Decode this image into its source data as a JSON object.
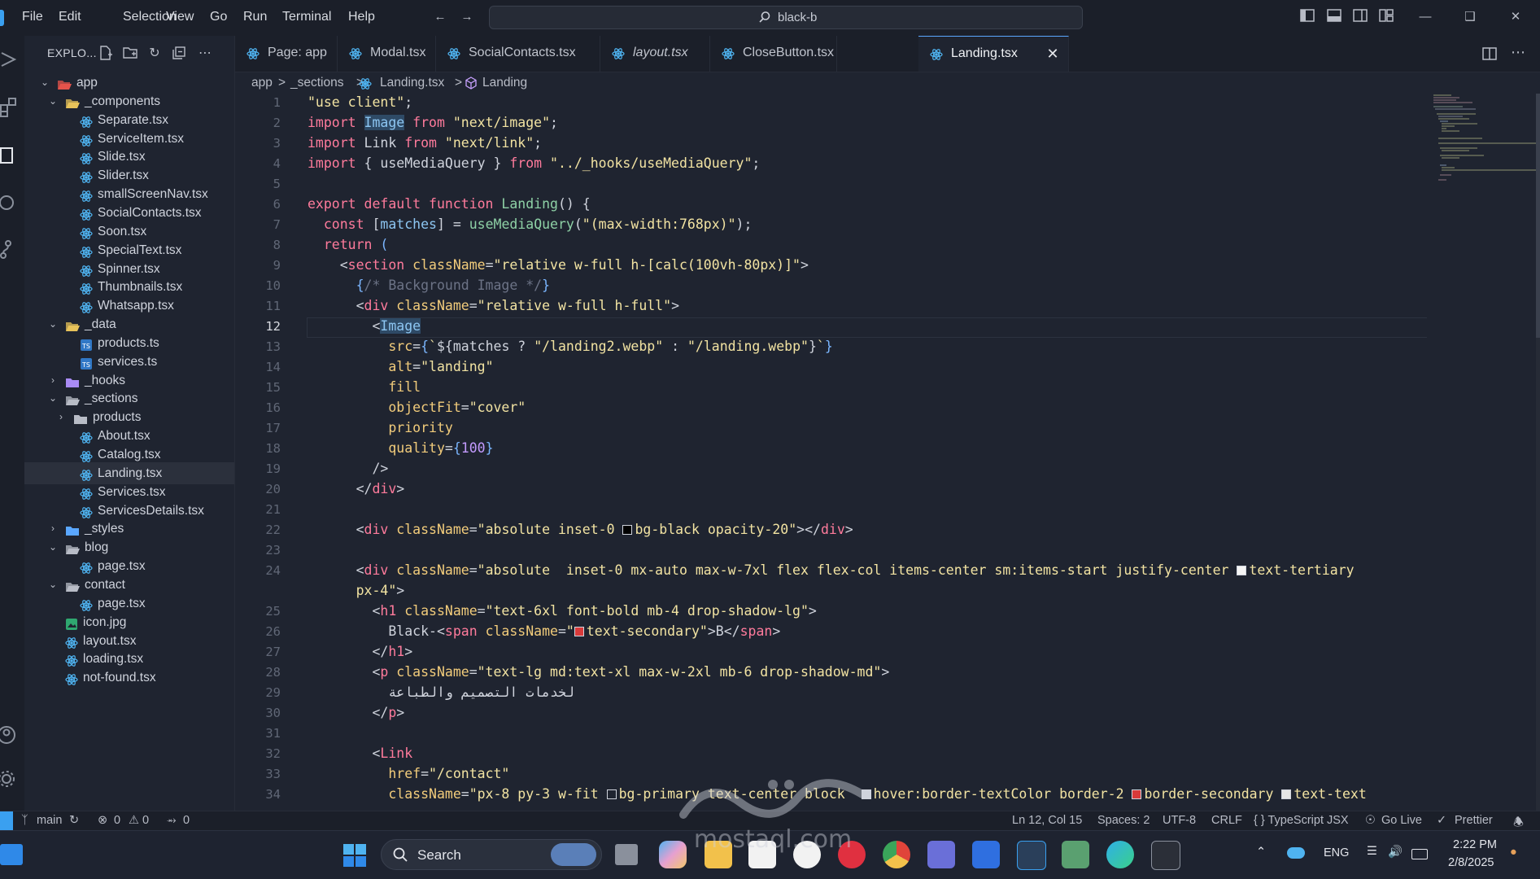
{
  "menu": [
    "File",
    "Edit",
    "Selection",
    "View",
    "Go",
    "Run",
    "Terminal",
    "Help"
  ],
  "command_center": {
    "text": "black-b"
  },
  "sidebar": {
    "title": "EXPLO...",
    "tree": [
      {
        "label": "app",
        "depth": 0,
        "kind": "folder-open",
        "color": "#e5534b"
      },
      {
        "label": "_components",
        "depth": 1,
        "kind": "folder-open",
        "color": "#e8c35a"
      },
      {
        "label": "Separate.tsx",
        "depth": 2,
        "kind": "tsx"
      },
      {
        "label": "ServiceItem.tsx",
        "depth": 2,
        "kind": "tsx"
      },
      {
        "label": "Slide.tsx",
        "depth": 2,
        "kind": "tsx"
      },
      {
        "label": "Slider.tsx",
        "depth": 2,
        "kind": "tsx"
      },
      {
        "label": "smallScreenNav.tsx",
        "depth": 2,
        "kind": "tsx"
      },
      {
        "label": "SocialContacts.tsx",
        "depth": 2,
        "kind": "tsx"
      },
      {
        "label": "Soon.tsx",
        "depth": 2,
        "kind": "tsx"
      },
      {
        "label": "SpecialText.tsx",
        "depth": 2,
        "kind": "tsx"
      },
      {
        "label": "Spinner.tsx",
        "depth": 2,
        "kind": "tsx"
      },
      {
        "label": "Thumbnails.tsx",
        "depth": 2,
        "kind": "tsx"
      },
      {
        "label": "Whatsapp.tsx",
        "depth": 2,
        "kind": "tsx"
      },
      {
        "label": "_data",
        "depth": 1,
        "kind": "folder-open",
        "color": "#e8c35a"
      },
      {
        "label": "products.ts",
        "depth": 2,
        "kind": "ts"
      },
      {
        "label": "services.ts",
        "depth": 2,
        "kind": "ts"
      },
      {
        "label": "_hooks",
        "depth": 1,
        "kind": "folder-closed",
        "color": "#a98bf5"
      },
      {
        "label": "_sections",
        "depth": 1,
        "kind": "folder-open",
        "color": "#b8bcc6"
      },
      {
        "label": "products",
        "depth": 2,
        "kind": "folder-closed",
        "color": "#b8bcc6"
      },
      {
        "label": "About.tsx",
        "depth": 2,
        "kind": "tsx"
      },
      {
        "label": "Catalog.tsx",
        "depth": 2,
        "kind": "tsx"
      },
      {
        "label": "Landing.tsx",
        "depth": 2,
        "kind": "tsx",
        "active": true
      },
      {
        "label": "Services.tsx",
        "depth": 2,
        "kind": "tsx"
      },
      {
        "label": "ServicesDetails.tsx",
        "depth": 2,
        "kind": "tsx"
      },
      {
        "label": "_styles",
        "depth": 1,
        "kind": "folder-closed",
        "color": "#5aa7ff"
      },
      {
        "label": "blog",
        "depth": 1,
        "kind": "folder-open",
        "color": "#b8bcc6"
      },
      {
        "label": "page.tsx",
        "depth": 2,
        "kind": "tsx"
      },
      {
        "label": "contact",
        "depth": 1,
        "kind": "folder-open",
        "color": "#b8bcc6"
      },
      {
        "label": "page.tsx",
        "depth": 2,
        "kind": "tsx"
      },
      {
        "label": "icon.jpg",
        "depth": 1,
        "kind": "img"
      },
      {
        "label": "layout.tsx",
        "depth": 1,
        "kind": "tsx"
      },
      {
        "label": "loading.tsx",
        "depth": 1,
        "kind": "tsx"
      },
      {
        "label": "not-found.tsx",
        "depth": 1,
        "kind": "tsx"
      }
    ]
  },
  "tabs": [
    {
      "label": "Page: app",
      "italic": false
    },
    {
      "label": "Modal.tsx",
      "italic": false
    },
    {
      "label": "SocialContacts.tsx",
      "italic": false
    },
    {
      "label": "layout.tsx",
      "italic": true
    },
    {
      "label": "CloseButton.tsx",
      "italic": false
    },
    {
      "label": "Landing.tsx",
      "italic": false,
      "active": true
    }
  ],
  "breadcrumb": [
    "app",
    ">",
    "_sections",
    ">",
    "Landing.tsx",
    ">",
    "Landing"
  ],
  "editor": {
    "current_line": 12,
    "lines": [
      {
        "n": "1",
        "code": [
          [
            "str",
            "\"use client\""
          ],
          [
            "p",
            ";"
          ]
        ]
      },
      {
        "n": "2",
        "code": [
          [
            "kw",
            "import "
          ],
          [
            "selvar",
            "Image"
          ],
          [
            "kw",
            " from "
          ],
          [
            "str",
            "\"next/image\""
          ],
          [
            "p",
            ";"
          ]
        ]
      },
      {
        "n": "3",
        "code": [
          [
            "kw",
            "import "
          ],
          [
            "p",
            "Link "
          ],
          [
            "kw",
            "from "
          ],
          [
            "str",
            "\"next/link\""
          ],
          [
            "p",
            ";"
          ]
        ]
      },
      {
        "n": "4",
        "code": [
          [
            "kw",
            "import "
          ],
          [
            "p",
            "{ useMediaQuery } "
          ],
          [
            "kw",
            "from "
          ],
          [
            "str",
            "\"../_hooks/useMediaQuery\""
          ],
          [
            "p",
            ";"
          ]
        ]
      },
      {
        "n": "5",
        "code": []
      },
      {
        "n": "6",
        "code": [
          [
            "kw",
            "export default function "
          ],
          [
            "fn",
            "Landing"
          ],
          [
            "p",
            "() {"
          ]
        ]
      },
      {
        "n": "7",
        "code": [
          [
            "p",
            "  "
          ],
          [
            "kw",
            "const "
          ],
          [
            "p",
            "["
          ],
          [
            "var",
            "matches"
          ],
          [
            "p",
            "] = "
          ],
          [
            "fn",
            "useMediaQuery"
          ],
          [
            "p",
            "("
          ],
          [
            "str",
            "\"(max-width:768px)\""
          ],
          [
            "p",
            ");"
          ]
        ]
      },
      {
        "n": "8",
        "code": [
          [
            "p",
            "  "
          ],
          [
            "kw",
            "return "
          ],
          [
            "br",
            "("
          ]
        ]
      },
      {
        "n": "9",
        "code": [
          [
            "p",
            "    <"
          ],
          [
            "tag",
            "section "
          ],
          [
            "attr",
            "className"
          ],
          [
            "p",
            "="
          ],
          [
            "str",
            "\"relative w-full h-[calc(100vh-80px)]\""
          ],
          [
            "p",
            ">"
          ]
        ]
      },
      {
        "n": "10",
        "code": [
          [
            "p",
            "      "
          ],
          [
            "br",
            "{"
          ],
          [
            "com",
            "/* Background Image */"
          ],
          [
            "br",
            "}"
          ]
        ]
      },
      {
        "n": "11",
        "code": [
          [
            "p",
            "      <"
          ],
          [
            "tag",
            "div "
          ],
          [
            "attr",
            "className"
          ],
          [
            "p",
            "="
          ],
          [
            "str",
            "\"relative w-full h-full\""
          ],
          [
            "p",
            ">"
          ]
        ]
      },
      {
        "n": "12",
        "code": [
          [
            "p",
            "        <"
          ],
          [
            "selvar",
            "Image"
          ]
        ]
      },
      {
        "n": "13",
        "code": [
          [
            "p",
            "          "
          ],
          [
            "attr",
            "src"
          ],
          [
            "p",
            "="
          ],
          [
            "br",
            "{"
          ],
          [
            "str",
            "`"
          ],
          [
            "p",
            "${matches ? "
          ],
          [
            "str",
            "\"/landing2.webp\""
          ],
          [
            "p",
            " : "
          ],
          [
            "str",
            "\"/landing.webp\""
          ],
          [
            "p",
            "}"
          ],
          [
            "str",
            "`"
          ],
          [
            "br",
            "}"
          ]
        ]
      },
      {
        "n": "14",
        "code": [
          [
            "p",
            "          "
          ],
          [
            "attr",
            "alt"
          ],
          [
            "p",
            "="
          ],
          [
            "str",
            "\"landing\""
          ]
        ]
      },
      {
        "n": "15",
        "code": [
          [
            "p",
            "          "
          ],
          [
            "attr",
            "fill"
          ]
        ]
      },
      {
        "n": "16",
        "code": [
          [
            "p",
            "          "
          ],
          [
            "attr",
            "objectFit"
          ],
          [
            "p",
            "="
          ],
          [
            "str",
            "\"cover\""
          ]
        ]
      },
      {
        "n": "17",
        "code": [
          [
            "p",
            "          "
          ],
          [
            "attr",
            "priority"
          ]
        ]
      },
      {
        "n": "18",
        "code": [
          [
            "p",
            "          "
          ],
          [
            "attr",
            "quality"
          ],
          [
            "p",
            "="
          ],
          [
            "br",
            "{"
          ],
          [
            "num",
            "100"
          ],
          [
            "br",
            "}"
          ]
        ]
      },
      {
        "n": "19",
        "code": [
          [
            "p",
            "        />"
          ]
        ]
      },
      {
        "n": "20",
        "code": [
          [
            "p",
            "      </"
          ],
          [
            "tag",
            "div"
          ],
          [
            "p",
            ">"
          ]
        ]
      },
      {
        "n": "21",
        "code": []
      },
      {
        "n": "22",
        "code": [
          [
            "p",
            "      <"
          ],
          [
            "tag",
            "div "
          ],
          [
            "attr",
            "className"
          ],
          [
            "p",
            "="
          ],
          [
            "str",
            "\"absolute inset-0 "
          ],
          [
            "sw",
            "#000000"
          ],
          [
            "str",
            "bg-black opacity-20\""
          ],
          [
            "p",
            "></"
          ],
          [
            "tag",
            "div"
          ],
          [
            "p",
            ">"
          ]
        ]
      },
      {
        "n": "23",
        "code": []
      },
      {
        "n": "24",
        "code": [
          [
            "p",
            "      <"
          ],
          [
            "tag",
            "div "
          ],
          [
            "attr",
            "className"
          ],
          [
            "p",
            "="
          ],
          [
            "str",
            "\"absolute  inset-0 mx-auto max-w-7xl flex flex-col items-center sm:items-start justify-center "
          ],
          [
            "sw",
            "#f5f5f5"
          ],
          [
            "str",
            "text-tertiary"
          ]
        ]
      },
      {
        "n": "",
        "code": [
          [
            "str",
            "      px-4\""
          ],
          [
            "p",
            ">"
          ]
        ]
      },
      {
        "n": "25",
        "code": [
          [
            "p",
            "        <"
          ],
          [
            "tag",
            "h1 "
          ],
          [
            "attr",
            "className"
          ],
          [
            "p",
            "="
          ],
          [
            "str",
            "\"text-6xl font-bold mb-4 drop-shadow-lg\""
          ],
          [
            "p",
            ">"
          ]
        ]
      },
      {
        "n": "26",
        "code": [
          [
            "p",
            "          Black-<"
          ],
          [
            "tag",
            "span "
          ],
          [
            "attr",
            "className"
          ],
          [
            "p",
            "="
          ],
          [
            "str",
            "\""
          ],
          [
            "sw",
            "#d93a3a"
          ],
          [
            "str",
            "text-secondary\""
          ],
          [
            "p",
            ">B</"
          ],
          [
            "tag",
            "span"
          ],
          [
            "p",
            ">"
          ]
        ]
      },
      {
        "n": "27",
        "code": [
          [
            "p",
            "        </"
          ],
          [
            "tag",
            "h1"
          ],
          [
            "p",
            ">"
          ]
        ]
      },
      {
        "n": "28",
        "code": [
          [
            "p",
            "        <"
          ],
          [
            "tag",
            "p "
          ],
          [
            "attr",
            "className"
          ],
          [
            "p",
            "="
          ],
          [
            "str",
            "\"text-lg md:text-xl max-w-2xl mb-6 drop-shadow-md\""
          ],
          [
            "p",
            ">"
          ]
        ]
      },
      {
        "n": "29",
        "code": [
          [
            "p",
            "          لخدمات التصميم والطباعة"
          ]
        ]
      },
      {
        "n": "30",
        "code": [
          [
            "p",
            "        </"
          ],
          [
            "tag",
            "p"
          ],
          [
            "p",
            ">"
          ]
        ]
      },
      {
        "n": "31",
        "code": []
      },
      {
        "n": "32",
        "code": [
          [
            "p",
            "        <"
          ],
          [
            "tag",
            "Link"
          ]
        ]
      },
      {
        "n": "33",
        "code": [
          [
            "p",
            "          "
          ],
          [
            "attr",
            "href"
          ],
          [
            "p",
            "="
          ],
          [
            "str",
            "\"/contact\""
          ]
        ]
      },
      {
        "n": "34",
        "code": [
          [
            "p",
            "          "
          ],
          [
            "attr",
            "className"
          ],
          [
            "p",
            "="
          ],
          [
            "str",
            "\"px-8 py-3 w-fit "
          ],
          [
            "sw",
            "#1f2430"
          ],
          [
            "str",
            "bg-primary text-center block  "
          ],
          [
            "sw",
            "#cfd3dc"
          ],
          [
            "str",
            "hover:border-textColor border-2 "
          ],
          [
            "sw",
            "#d93a3a"
          ],
          [
            "str",
            "border-secondary "
          ],
          [
            "sw",
            "#e5e5e5"
          ],
          [
            "str",
            "text-text"
          ]
        ]
      }
    ]
  },
  "statusbar": {
    "branch": "main",
    "errors": "0",
    "warnings": "0",
    "ports": "0",
    "position": "Ln 12, Col 15",
    "spaces": "Spaces: 2",
    "encoding": "UTF-8",
    "eol": "CRLF",
    "language": "{ } TypeScript JSX",
    "golive": "Go Live",
    "prettier": "Prettier"
  },
  "taskbar": {
    "search_label": "Search",
    "lang": "ENG",
    "time": "2:22 PM",
    "date": "2/8/2025"
  },
  "watermark": {
    "text": "mostaql.com"
  },
  "colors": {
    "accent": "#5aa7ff",
    "bg": "#1f2430",
    "chrome": "#1b1f29",
    "tsx_icon": "#4fb3f0"
  }
}
